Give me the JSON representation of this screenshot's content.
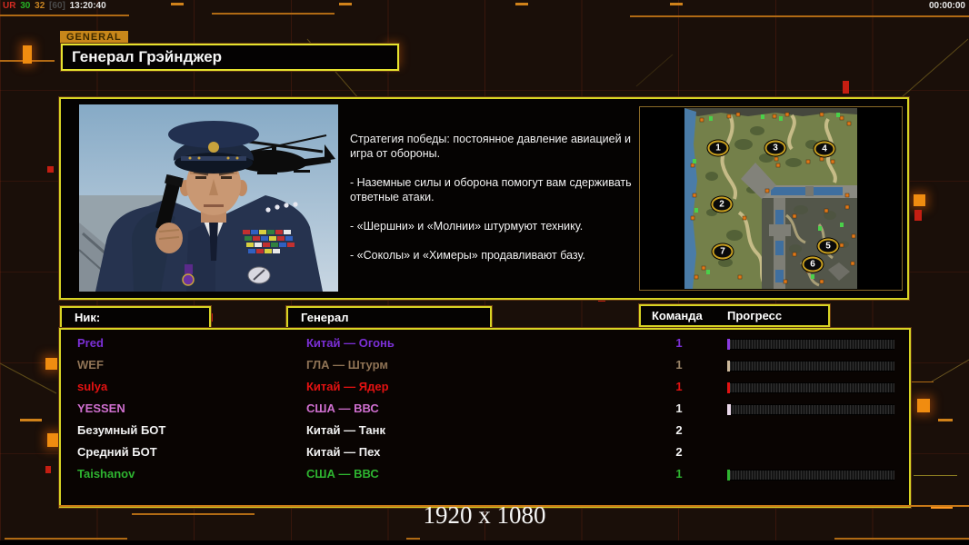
{
  "status_bar": {
    "net": "UR",
    "fps": "30",
    "ping": "32",
    "limit": "[60]",
    "clock": "13:20:40",
    "match_timer": "00:00:00"
  },
  "header": {
    "tab": "GENERAL",
    "title": "Генерал Грэйнджер"
  },
  "briefing": {
    "p1": "Стратегия победы: постоянное давление авиацией и игра от обороны.",
    "p2": "- Наземные силы и оборона помогут вам сдерживать ответные атаки.",
    "p3": "- «Шершни» и «Молнии» штурмуют технику.",
    "p4": "- «Соколы» и «Химеры» продавливают базу."
  },
  "minimap": {
    "markers": [
      "1",
      "2",
      "3",
      "4",
      "5",
      "6",
      "7"
    ]
  },
  "table": {
    "headers": {
      "nick": "Ник:",
      "general": "Генерал",
      "team": "Команда",
      "progress": "Прогресс"
    }
  },
  "players": [
    {
      "name": "Pred",
      "general": "Китай — Огонь",
      "team": "1",
      "color": "#7b2fd6",
      "team_color": "#7b2fd6",
      "tick": "#8a3ae0",
      "has_progress": true
    },
    {
      "name": "WEF",
      "general": "ГЛА — Штурм",
      "team": "1",
      "color": "#8f7355",
      "team_color": "#9a8468",
      "tick": "#cbb79a",
      "has_progress": true
    },
    {
      "name": "sulya",
      "general": "Китай — Ядер",
      "team": "1",
      "color": "#e31212",
      "team_color": "#e31212",
      "tick": "#e31212",
      "has_progress": true
    },
    {
      "name": "YESSEN",
      "general": "США — ВВС",
      "team": "1",
      "color": "#cf6fcf",
      "team_color": "#e8e8e8",
      "tick": "#ead8ea",
      "has_progress": true
    },
    {
      "name": "Безумный БОТ",
      "general": "Китай — Танк",
      "team": "2",
      "color": "#f2f2f2",
      "team_color": "#f2f2f2",
      "tick": "",
      "has_progress": false
    },
    {
      "name": "Средний БОТ",
      "general": "Китай — Пех",
      "team": "2",
      "color": "#f2f2f2",
      "team_color": "#f2f2f2",
      "tick": "",
      "has_progress": false
    },
    {
      "name": "Taishanov",
      "general": "США — ВВС",
      "team": "1",
      "color": "#2eb430",
      "team_color": "#2eb430",
      "tick": "#2eb430",
      "has_progress": true
    }
  ],
  "footer": {
    "resolution": "1920 x 1080"
  },
  "colors": {
    "accent_yellow": "#d8d424",
    "accent_orange": "#c87818",
    "status_net": "#d22b22",
    "status_fps": "#25b325",
    "status_ping": "#c88422"
  }
}
